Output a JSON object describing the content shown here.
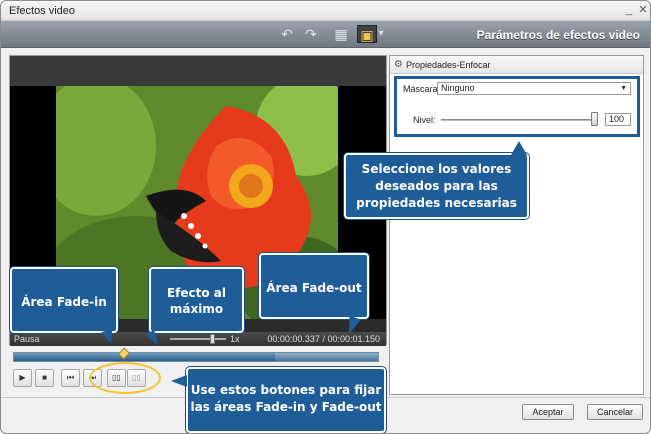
{
  "window": {
    "title": "Efectos video",
    "min_glyph": "_",
    "close_glyph": "✕"
  },
  "toolbar": {
    "undo_glyph": "↶",
    "redo_glyph": "↷",
    "grid_glyph": "▦",
    "monitor_glyph": "▣",
    "dropdown_glyph": "▾",
    "panel_title": "Parámetros de efectos video"
  },
  "player": {
    "status": "Pausa",
    "speed": "1x",
    "time": "00:00:00.337 / 00:00:01.150",
    "timeline_played_fraction": 0.716
  },
  "controls": {
    "play": "▶",
    "stop": "■",
    "prev": "⏮",
    "next": "⏭",
    "fade_in": "▯▯",
    "fade_out": "▯▯"
  },
  "properties": {
    "header": "Propiedades-Enfocar",
    "mask_label": "Máscara",
    "mask_value": "Ninguno",
    "level_label": "Nivel:",
    "level_value": "100",
    "level_fraction": 1.0
  },
  "footer": {
    "ok": "Aceptar",
    "cancel": "Cancelar"
  },
  "callouts": {
    "props": "Seleccione los valores deseados para las propiedades necesarias",
    "fade_in": "Área Fade-in",
    "max": "Efecto al máximo",
    "fade_out": "Área Fade-out",
    "buttons": "Use estos botones para fijar las áreas Fade-in y Fade-out"
  },
  "colors": {
    "accent": "#1f5d99",
    "highlight": "#f4c430"
  }
}
